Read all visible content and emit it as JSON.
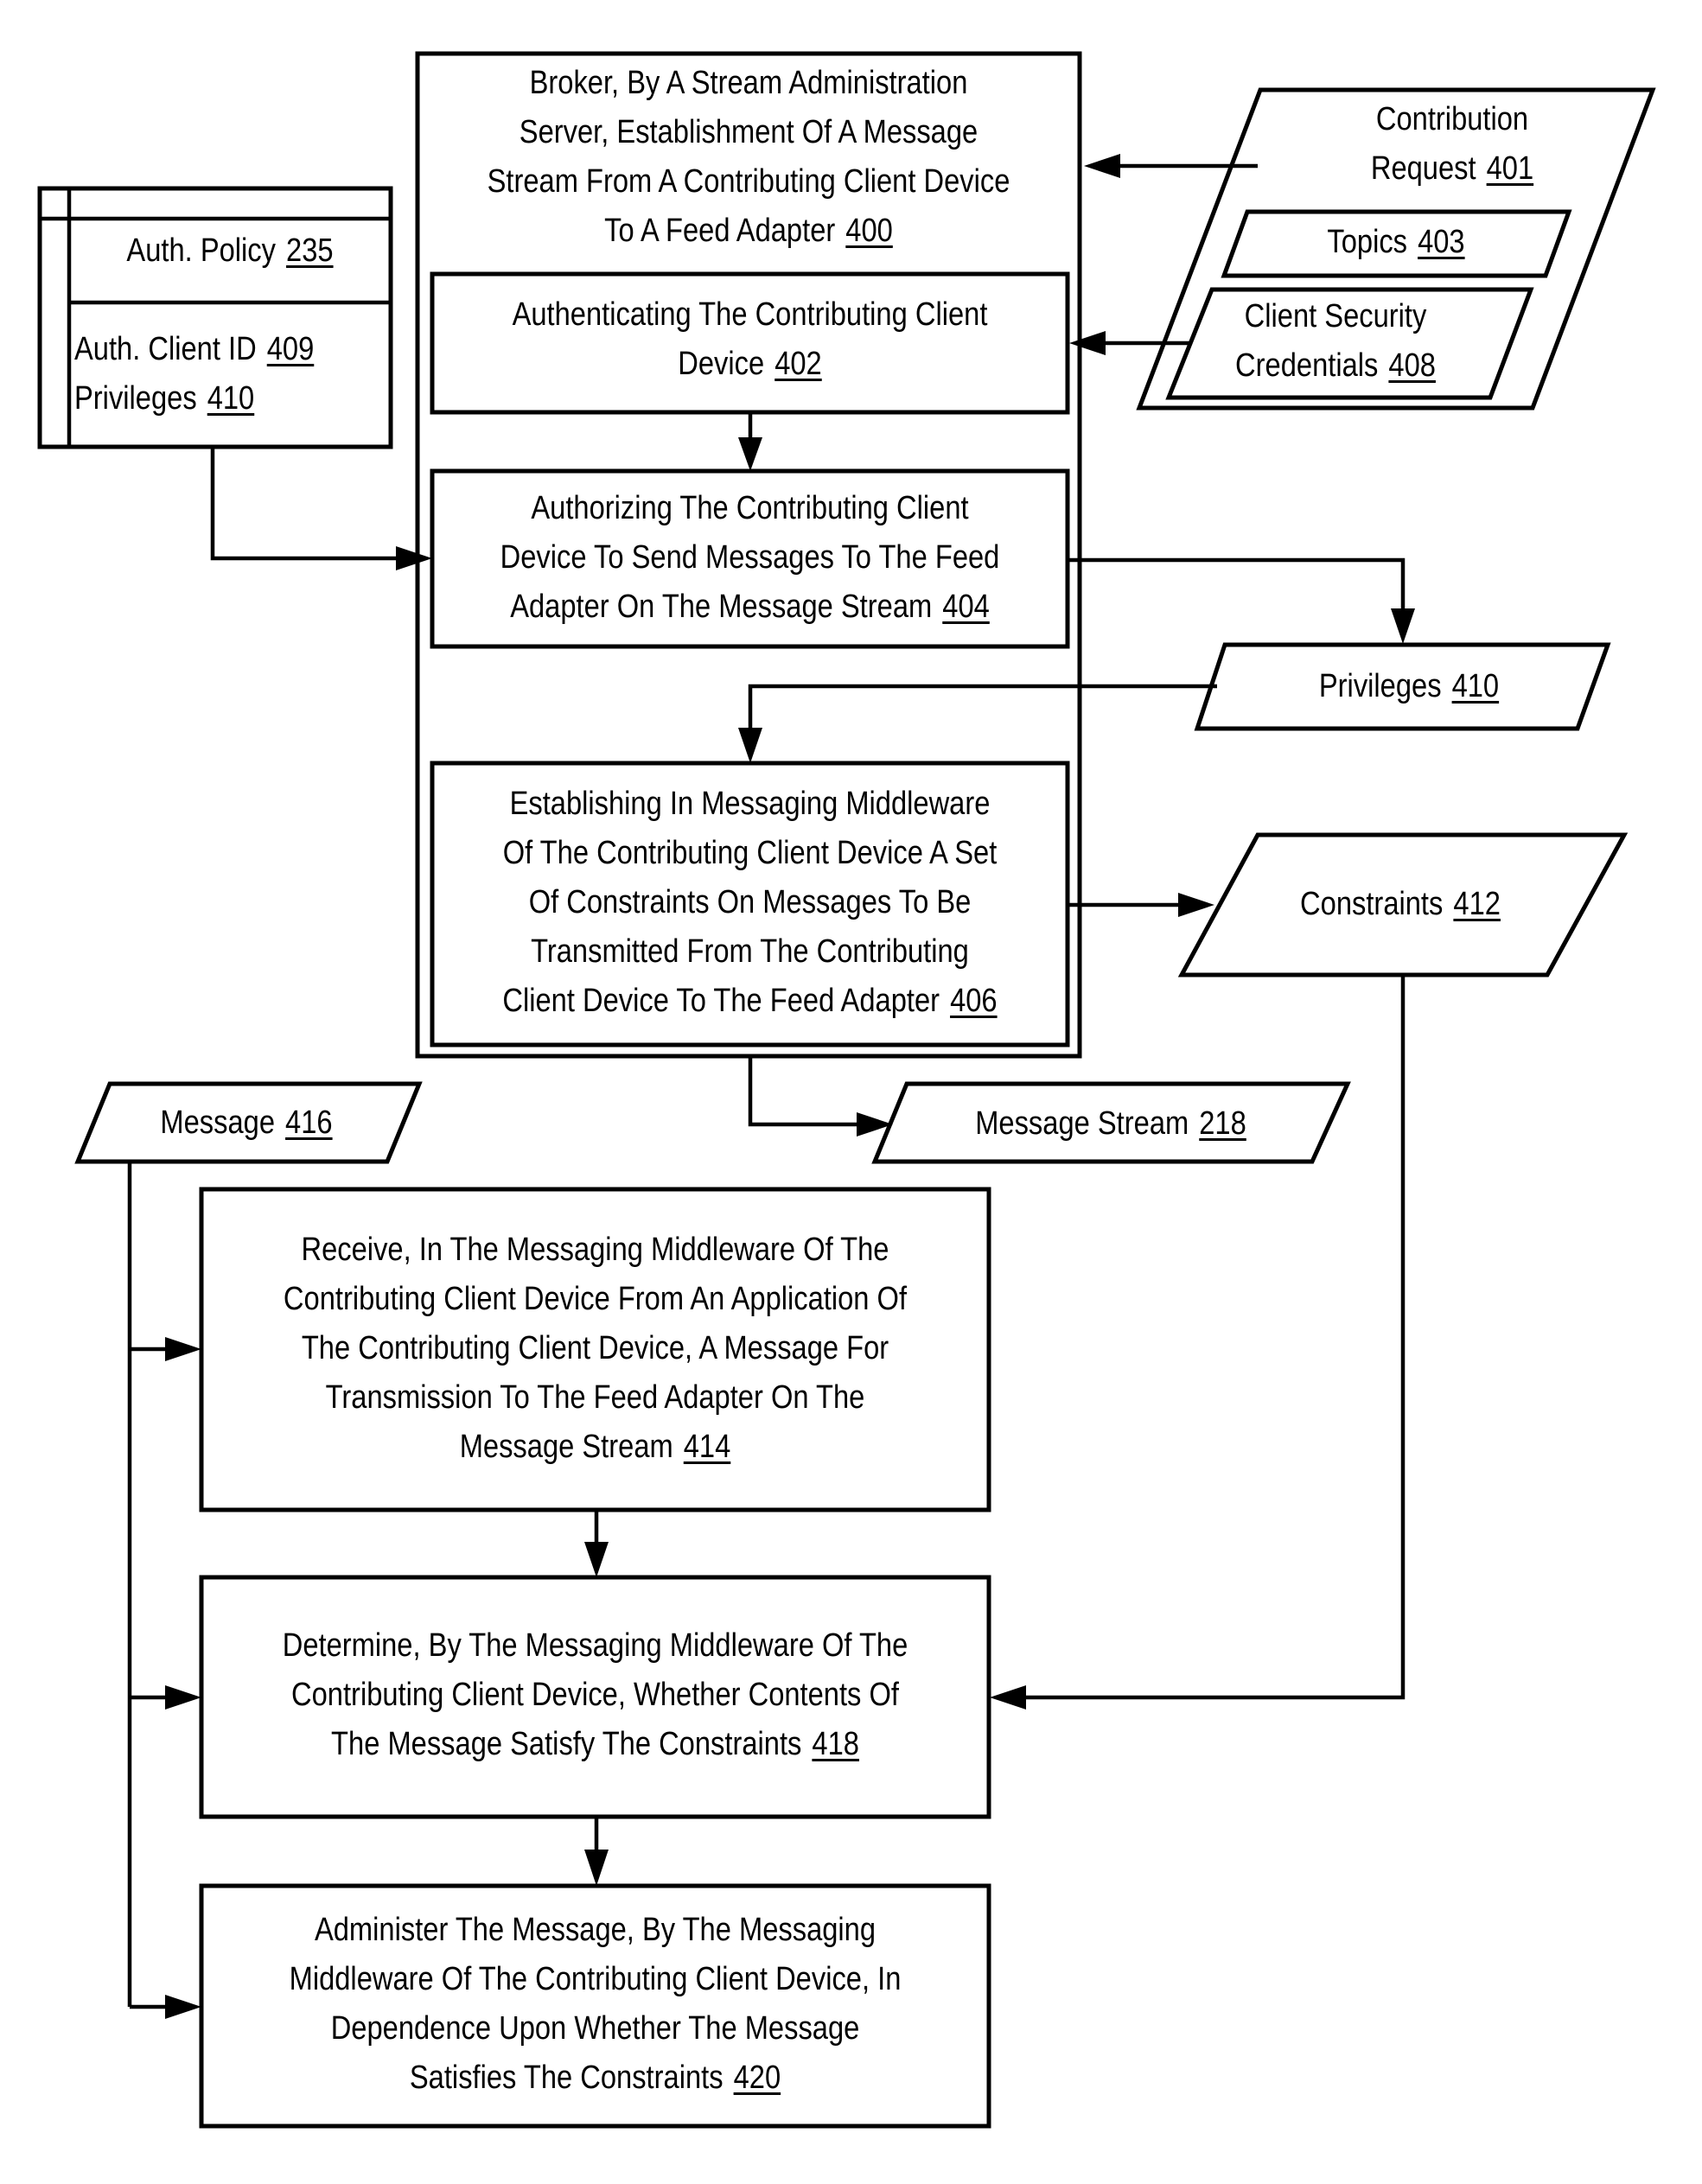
{
  "diagram": {
    "type": "flowchart",
    "steps": {
      "broker": {
        "text": "Broker, By A Stream Administration Server, Establishment Of A Message Stream From A Contributing Client Device To A Feed Adapter",
        "lines": [
          "Broker, By A Stream Administration",
          "Server, Establishment Of A Message",
          "Stream From A Contributing Client Device",
          "To A Feed Adapter"
        ],
        "ref": "400"
      },
      "authenticate": {
        "lines": [
          "Authenticating The Contributing Client",
          "Device"
        ],
        "ref": "402"
      },
      "authorize": {
        "lines": [
          "Authorizing The Contributing Client",
          "Device To Send Messages To The Feed",
          "Adapter On The Message Stream"
        ],
        "ref": "404"
      },
      "establish": {
        "lines": [
          "Establishing In Messaging Middleware",
          "Of The Contributing Client Device A Set",
          "Of Constraints On Messages To Be",
          "Transmitted From The Contributing",
          "Client Device To The Feed Adapter"
        ],
        "ref": "406"
      },
      "receive": {
        "lines": [
          "Receive, In The Messaging Middleware Of The",
          "Contributing Client Device From An Application Of",
          "The Contributing Client Device, A Message For",
          "Transmission To The Feed Adapter On The",
          "Message Stream"
        ],
        "ref": "414"
      },
      "determine": {
        "lines": [
          "Determine, By The Messaging Middleware Of The",
          "Contributing Client Device, Whether Contents Of",
          "The Message Satisfy The Constraints"
        ],
        "ref": "418"
      },
      "administer": {
        "lines": [
          "Administer The Message, By The Messaging",
          "Middleware Of The Contributing Client Device, In",
          "Dependence Upon Whether The Message",
          "Satisfies The Constraints"
        ],
        "ref": "420"
      }
    },
    "data_items": {
      "auth_policy": {
        "title": "Auth. Policy",
        "ref": "235",
        "fields": [
          {
            "label": "Auth. Client ID",
            "ref": "409"
          },
          {
            "label": "Privileges",
            "ref": "410"
          }
        ]
      },
      "contribution_request": {
        "lines": [
          "Contribution",
          "Request"
        ],
        "ref": "401"
      },
      "topics": {
        "label": "Topics",
        "ref": "403"
      },
      "credentials": {
        "lines": [
          "Client Security",
          "Credentials"
        ],
        "ref": "408"
      },
      "privileges": {
        "label": "Privileges",
        "ref": "410"
      },
      "constraints": {
        "label": "Constraints",
        "ref": "412"
      },
      "message": {
        "label": "Message",
        "ref": "416"
      },
      "message_stream": {
        "label": "Message Stream",
        "ref": "218"
      }
    },
    "edges": [
      {
        "from": "contribution_request",
        "to": "broker"
      },
      {
        "from": "credentials",
        "to": "authenticate"
      },
      {
        "from": "authenticate",
        "to": "authorize"
      },
      {
        "from": "auth_policy",
        "to": "authorize"
      },
      {
        "from": "authorize",
        "to": "privileges"
      },
      {
        "from": "privileges",
        "to": "establish"
      },
      {
        "from": "establish",
        "to": "constraints"
      },
      {
        "from": "broker",
        "to": "message_stream"
      },
      {
        "from": "message",
        "to": "receive"
      },
      {
        "from": "message",
        "to": "determine"
      },
      {
        "from": "message",
        "to": "administer"
      },
      {
        "from": "receive",
        "to": "determine"
      },
      {
        "from": "constraints",
        "to": "determine"
      },
      {
        "from": "determine",
        "to": "administer"
      }
    ]
  }
}
